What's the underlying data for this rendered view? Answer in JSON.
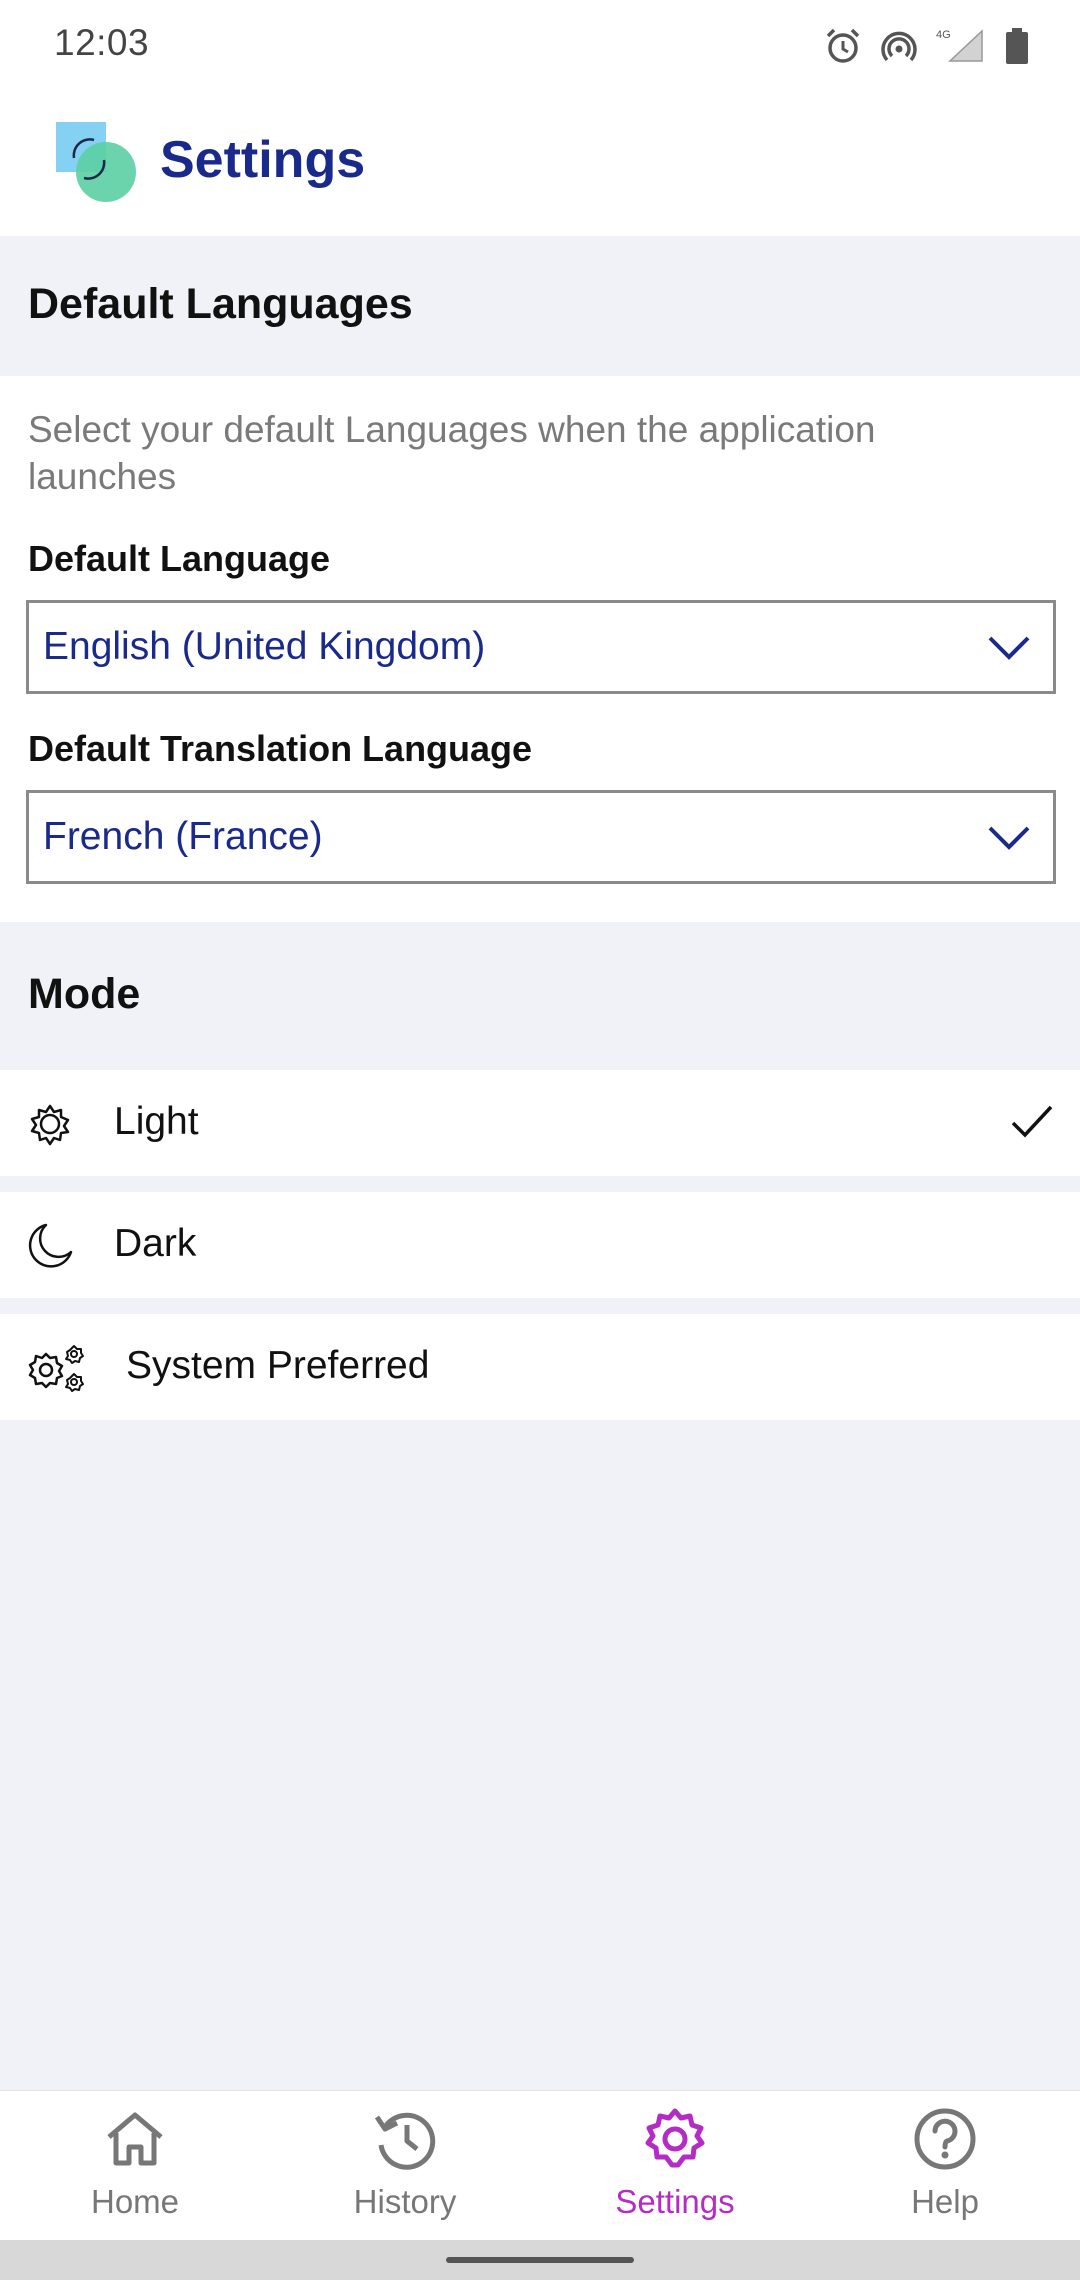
{
  "status_bar": {
    "time": "12:03",
    "icons": [
      "alarm-icon",
      "hotspot-icon",
      "4g-signal-icon",
      "battery-icon"
    ],
    "network_label": "4G"
  },
  "header": {
    "title": "Settings",
    "logo_icon": "app-logo-icon",
    "title_color": "#1a2a8c"
  },
  "languages": {
    "section_title": "Default Languages",
    "description": "Select your default Languages when the  application launches",
    "default_language": {
      "label": "Default Language",
      "value": "English (United Kingdom)"
    },
    "translation_language": {
      "label": "Default Translation Language",
      "value": "French (France)"
    }
  },
  "mode": {
    "section_title": "Mode",
    "options": [
      {
        "label": "Light",
        "icon": "sun-icon",
        "selected": true
      },
      {
        "label": "Dark",
        "icon": "moon-icon",
        "selected": false
      },
      {
        "label": "System Preferred",
        "icon": "gears-icon",
        "selected": false
      }
    ]
  },
  "bottom_nav": {
    "items": [
      {
        "label": "Home",
        "icon": "home-icon",
        "active": false
      },
      {
        "label": "History",
        "icon": "history-icon",
        "active": false
      },
      {
        "label": "Settings",
        "icon": "settings-gear-icon",
        "active": true
      },
      {
        "label": "Help",
        "icon": "help-icon",
        "active": false
      }
    ],
    "active_color": "#b52bc6",
    "inactive_color": "#777777"
  }
}
